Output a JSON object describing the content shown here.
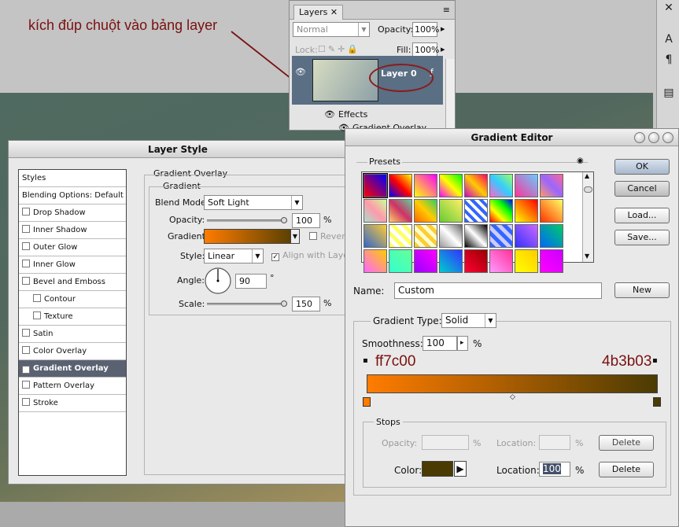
{
  "annotation": "kích đúp chuột vào bảng layer",
  "colors": {
    "start": "#ff7c00",
    "end": "#4b3b03",
    "annotation": "#7a1010"
  },
  "layers_panel": {
    "tab": "Layers",
    "blend_mode": "Normal",
    "opacity_label": "Opacity:",
    "opacity_value": "100%",
    "lock_label": "Lock:",
    "fill_label": "Fill:",
    "fill_value": "100%",
    "layer_name": "Layer 0",
    "effects_label": "Effects",
    "sub_effect": "Gradient Overlay"
  },
  "layer_style": {
    "title": "Layer Style",
    "styles_items": [
      {
        "label": "Styles",
        "checkbox": false,
        "checked": false,
        "selected": false,
        "indent": false
      },
      {
        "label": "Blending Options: Default",
        "checkbox": false,
        "checked": false,
        "selected": false,
        "indent": false
      },
      {
        "label": "Drop Shadow",
        "checkbox": true,
        "checked": false,
        "selected": false,
        "indent": false
      },
      {
        "label": "Inner Shadow",
        "checkbox": true,
        "checked": false,
        "selected": false,
        "indent": false
      },
      {
        "label": "Outer Glow",
        "checkbox": true,
        "checked": false,
        "selected": false,
        "indent": false
      },
      {
        "label": "Inner Glow",
        "checkbox": true,
        "checked": false,
        "selected": false,
        "indent": false
      },
      {
        "label": "Bevel and Emboss",
        "checkbox": true,
        "checked": false,
        "selected": false,
        "indent": false
      },
      {
        "label": "Contour",
        "checkbox": true,
        "checked": false,
        "selected": false,
        "indent": true
      },
      {
        "label": "Texture",
        "checkbox": true,
        "checked": false,
        "selected": false,
        "indent": true
      },
      {
        "label": "Satin",
        "checkbox": true,
        "checked": false,
        "selected": false,
        "indent": false
      },
      {
        "label": "Color Overlay",
        "checkbox": true,
        "checked": false,
        "selected": false,
        "indent": false
      },
      {
        "label": "Gradient Overlay",
        "checkbox": true,
        "checked": true,
        "selected": true,
        "indent": false
      },
      {
        "label": "Pattern Overlay",
        "checkbox": true,
        "checked": false,
        "selected": false,
        "indent": false
      },
      {
        "label": "Stroke",
        "checkbox": true,
        "checked": false,
        "selected": false,
        "indent": false
      }
    ],
    "section_title": "Gradient Overlay",
    "group_title": "Gradient",
    "blend_mode_label": "Blend Mode:",
    "blend_mode_value": "Soft Light",
    "opacity_label": "Opacity:",
    "opacity_value": "100",
    "percent": "%",
    "gradient_label": "Gradient:",
    "reverse_label": "Reverse",
    "style_label": "Style:",
    "style_value": "Linear",
    "align_label": "Align with Layer",
    "angle_label": "Angle:",
    "angle_value": "90",
    "degree": "°",
    "scale_label": "Scale:",
    "scale_value": "150"
  },
  "gradient_editor": {
    "title": "Gradient Editor",
    "presets_label": "Presets",
    "ok": "OK",
    "cancel": "Cancel",
    "load": "Load...",
    "save": "Save...",
    "name_label": "Name:",
    "name_value": "Custom",
    "new": "New",
    "gradient_type_label": "Gradient Type:",
    "gradient_type_value": "Solid",
    "smoothness_label": "Smoothness:",
    "smoothness_value": "100",
    "percent": "%",
    "start_hex": "ff7c00",
    "end_hex": "4b3b03",
    "stops_label": "Stops",
    "stop_opacity_label": "Opacity:",
    "stop_location_label": "Location:",
    "delete": "Delete",
    "color_label": "Color:",
    "location_value": "100",
    "presets": [
      "linear-gradient(45deg,#ff0000,#0000ff)",
      "linear-gradient(45deg,#0000ff,#ff0000,#ffff00)",
      "linear-gradient(45deg,#ffff00,#ff00ff)",
      "linear-gradient(45deg,#ff00ff,#ffff00,#00ff00)",
      "linear-gradient(45deg,#cc00cc,#ffcc00,#ff0066)",
      "linear-gradient(45deg,#ff66cc,#33ccff,#99ff66)",
      "linear-gradient(45deg,#ff3399,#66ccff)",
      "linear-gradient(45deg,#ff9966,#9966ff,#ff6699)",
      "linear-gradient(45deg,#aaddcc,#ff99aa,#ccff99)",
      "linear-gradient(45deg,#ffcc66,#cc3366,#66cc99)",
      "linear-gradient(45deg,#ff6600,#ffcc00,#33cc66)",
      "linear-gradient(45deg,#66cc33,#ffee66)",
      "repeating-linear-gradient(45deg,#3366ff 0 4px,#ffffff 4px 8px)",
      "linear-gradient(45deg,#ff0000,#ffff00,#00ff00,#0000ff)",
      "linear-gradient(45deg,#ffff00,#ff0000)",
      "linear-gradient(45deg,#ff3300,#ffff66)",
      "linear-gradient(45deg,#3366cc,#ffcc33)",
      "repeating-linear-gradient(45deg,#ffff66 0 5px,#ffffff 5px 10px)",
      "repeating-linear-gradient(45deg,#ffcc33 0 5px,#ffffcc 5px 10px)",
      "linear-gradient(45deg,#999999,#ffffff,#666666)",
      "linear-gradient(45deg,#000000,#ffffff,#000000)",
      "repeating-linear-gradient(45deg,#3366ff 0 5px,#ccccff 5px 10px)",
      "linear-gradient(45deg,#3333ff,#cc66ff)",
      "linear-gradient(45deg,#0066ff,#00cc66)",
      "linear-gradient(45deg,#ff66ff,#ffcc00)",
      "linear-gradient(45deg,#33ffcc,#66ff99)",
      "linear-gradient(45deg,#9900ff,#ff00ff)",
      "linear-gradient(45deg,#00cccc,#3333ff)",
      "linear-gradient(45deg,#ff0033,#990000)",
      "linear-gradient(45deg,#ff99ff,#ff3399)",
      "linear-gradient(45deg,#ffff00,#ffcc00)",
      "linear-gradient(45deg,#ff00ff,#cc00ff)"
    ]
  }
}
